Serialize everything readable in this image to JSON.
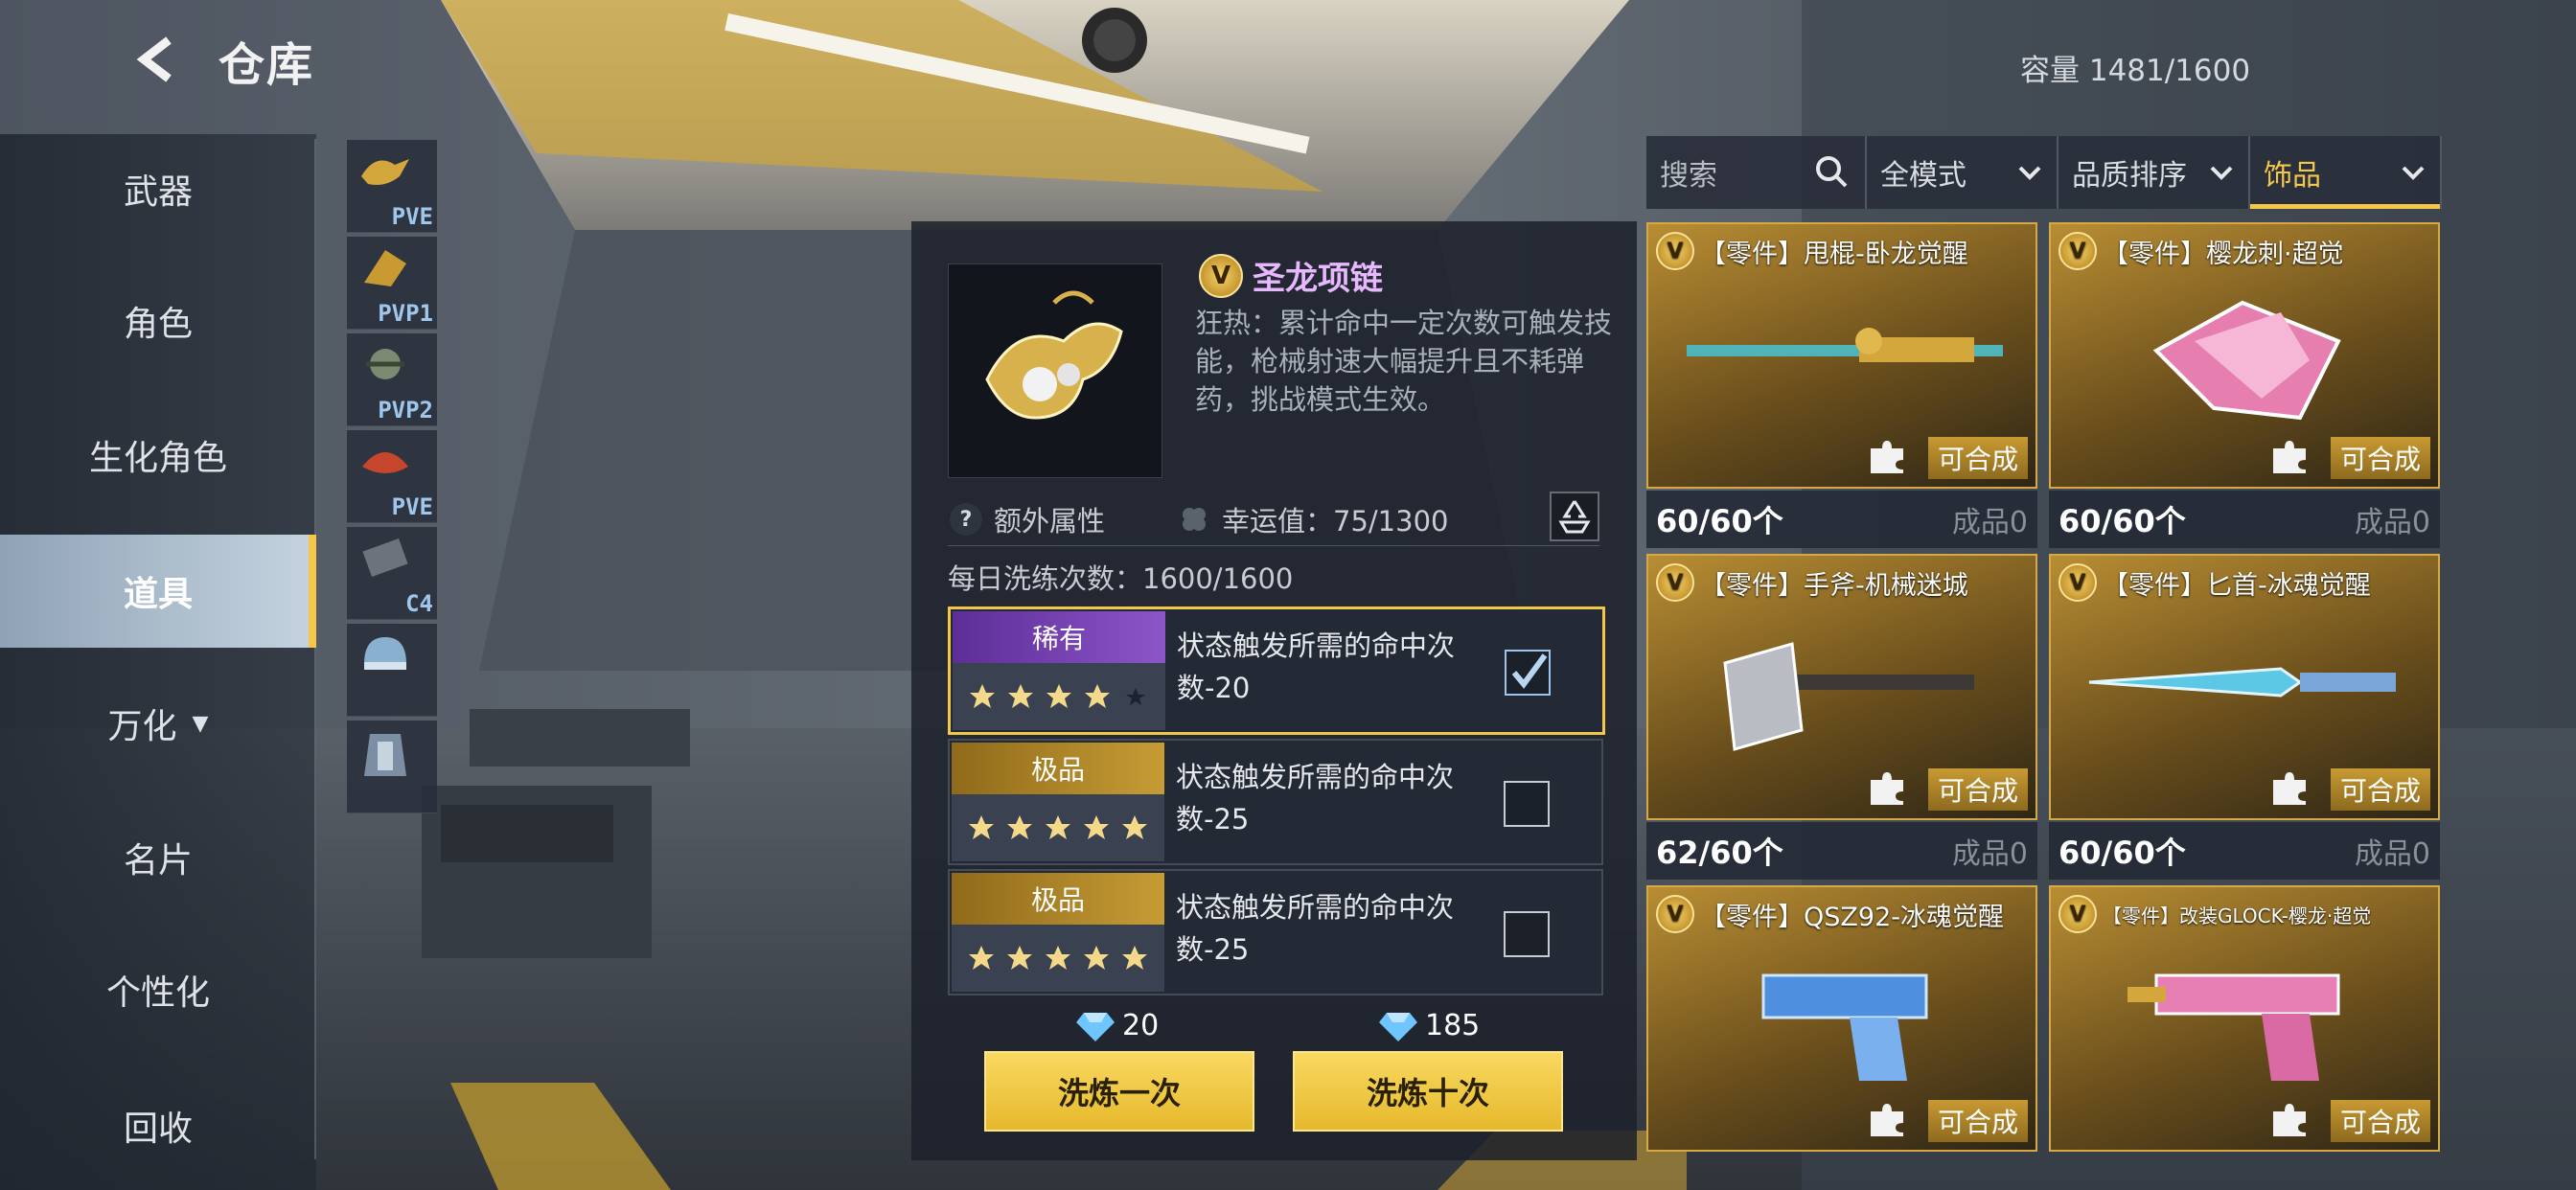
{
  "header": {
    "title": "仓库",
    "capacity": "容量 1481/1600"
  },
  "nav": {
    "items": [
      {
        "label": "武器"
      },
      {
        "label": "角色"
      },
      {
        "label": "生化角色"
      },
      {
        "label": "道具"
      },
      {
        "label": "万化"
      },
      {
        "label": "名片"
      },
      {
        "label": "个性化"
      },
      {
        "label": "回收"
      }
    ],
    "active_index": 3
  },
  "thumbs": [
    "PVE",
    "PVP1",
    "PVP2",
    "PVE",
    "C4",
    "",
    ""
  ],
  "detail": {
    "tier": "V",
    "name": "圣龙项链",
    "description": "狂热：累计命中一定次数可触发技能，枪械射速大幅提升且不耗弹药，挑战模式生效。",
    "help": "?",
    "extra_attr_label": "额外属性",
    "luck_label": "幸运值：75/1300",
    "daily_label": "每日洗练次数：1600/1600",
    "options": [
      {
        "rarity": "稀有",
        "stars": 4,
        "max_stars": 5,
        "text": "状态触发所需的命中次数-20",
        "checked": true
      },
      {
        "rarity": "极品",
        "stars": 5,
        "max_stars": 5,
        "text": "状态触发所需的命中次数-25",
        "checked": false
      },
      {
        "rarity": "极品",
        "stars": 5,
        "max_stars": 5,
        "text": "状态触发所需的命中次数-25",
        "checked": false
      }
    ],
    "cost_once": "20",
    "cost_ten": "185",
    "btn_once": "洗炼一次",
    "btn_ten": "洗炼十次"
  },
  "filters": {
    "search_placeholder": "搜索",
    "mode": "全模式",
    "sort": "品质排序",
    "category": "饰品"
  },
  "cards": [
    {
      "tier": "V",
      "title": "【零件】甩棍-卧龙觉醒",
      "synth": "可合成",
      "count": "60/60个",
      "done": "成品0"
    },
    {
      "tier": "V",
      "title": "【零件】樱龙刺·超觉",
      "synth": "可合成",
      "count": "60/60个",
      "done": "成品0"
    },
    {
      "tier": "V",
      "title": "【零件】手斧-机械迷城",
      "synth": "可合成",
      "count": "62/60个",
      "done": "成品0"
    },
    {
      "tier": "V",
      "title": "【零件】匕首-冰魂觉醒",
      "synth": "可合成",
      "count": "60/60个",
      "done": "成品0"
    },
    {
      "tier": "V",
      "title": "【零件】QSZ92-冰魂觉醒",
      "synth": "可合成"
    },
    {
      "tier": "V",
      "title": "【零件】改装GLOCK-樱龙·超觉",
      "synth": "可合成"
    }
  ],
  "colors": {
    "accent": "#f3c84a",
    "purple": "#8c55c8",
    "gold": "#c79c35",
    "name": "#e8b8ff"
  }
}
